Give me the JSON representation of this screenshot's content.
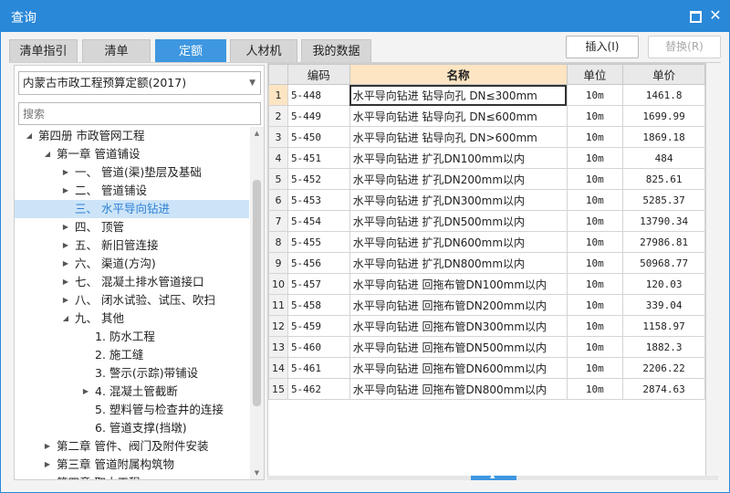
{
  "window": {
    "title": "查询"
  },
  "tabs": [
    {
      "label": "清单指引",
      "active": false
    },
    {
      "label": "清单",
      "active": false
    },
    {
      "label": "定额",
      "active": true
    },
    {
      "label": "人材机",
      "active": false
    },
    {
      "label": "我的数据",
      "active": false
    }
  ],
  "toolbar": {
    "insert_label": "插入(I)",
    "replace_label": "替换(R)"
  },
  "quota_select": {
    "value": "内蒙古市政工程预算定额(2017)"
  },
  "search": {
    "placeholder": "搜索"
  },
  "tree": [
    {
      "label": "第四册  市政管网工程",
      "level": 0,
      "toggle": "expanded",
      "selected": false
    },
    {
      "label": "第一章  管道铺设",
      "level": 1,
      "toggle": "expanded",
      "selected": false
    },
    {
      "label": "一、  管道(渠)垫层及基础",
      "level": 2,
      "toggle": "collapsed",
      "selected": false
    },
    {
      "label": "二、  管道铺设",
      "level": 2,
      "toggle": "collapsed",
      "selected": false
    },
    {
      "label": "三、  水平导向钻进",
      "level": 2,
      "toggle": "none",
      "selected": true
    },
    {
      "label": "四、  顶管",
      "level": 2,
      "toggle": "collapsed",
      "selected": false
    },
    {
      "label": "五、  新旧管连接",
      "level": 2,
      "toggle": "collapsed",
      "selected": false
    },
    {
      "label": "六、  渠道(方沟)",
      "level": 2,
      "toggle": "collapsed",
      "selected": false
    },
    {
      "label": "七、  混凝土排水管道接口",
      "level": 2,
      "toggle": "collapsed",
      "selected": false
    },
    {
      "label": "八、  闭水试验、试压、吹扫",
      "level": 2,
      "toggle": "collapsed",
      "selected": false
    },
    {
      "label": "九、  其他",
      "level": 2,
      "toggle": "expanded",
      "selected": false
    },
    {
      "label": "1. 防水工程",
      "level": 3,
      "toggle": "none",
      "selected": false
    },
    {
      "label": "2. 施工缝",
      "level": 3,
      "toggle": "none",
      "selected": false
    },
    {
      "label": "3. 警示(示踪)带铺设",
      "level": 3,
      "toggle": "none",
      "selected": false
    },
    {
      "label": "4. 混凝土管截断",
      "level": 3,
      "toggle": "collapsed",
      "selected": false
    },
    {
      "label": "5. 塑料管与检查井的连接",
      "level": 3,
      "toggle": "none",
      "selected": false
    },
    {
      "label": "6. 管道支撑(挡墩)",
      "level": 3,
      "toggle": "none",
      "selected": false
    },
    {
      "label": "第二章  管件、阀门及附件安装",
      "level": 1,
      "toggle": "collapsed",
      "selected": false
    },
    {
      "label": "第三章  管道附属构筑物",
      "level": 1,
      "toggle": "collapsed",
      "selected": false
    },
    {
      "label": "第四章  取水工程",
      "level": 1,
      "toggle": "collapsed",
      "selected": false
    }
  ],
  "grid": {
    "columns": [
      "编码",
      "名称",
      "单位",
      "单价"
    ],
    "rows": [
      {
        "no": "1",
        "code": "5-448",
        "name": "水平导向钻进 钻导向孔 DN≤300mm",
        "unit": "10m",
        "price": "1461.8"
      },
      {
        "no": "2",
        "code": "5-449",
        "name": "水平导向钻进 钻导向孔 DN≤600mm",
        "unit": "10m",
        "price": "1699.99"
      },
      {
        "no": "3",
        "code": "5-450",
        "name": "水平导向钻进 钻导向孔 DN>600mm",
        "unit": "10m",
        "price": "1869.18"
      },
      {
        "no": "4",
        "code": "5-451",
        "name": "水平导向钻进 扩孔DN100mm以内",
        "unit": "10m",
        "price": "484"
      },
      {
        "no": "5",
        "code": "5-452",
        "name": "水平导向钻进 扩孔DN200mm以内",
        "unit": "10m",
        "price": "825.61"
      },
      {
        "no": "6",
        "code": "5-453",
        "name": "水平导向钻进 扩孔DN300mm以内",
        "unit": "10m",
        "price": "5285.37"
      },
      {
        "no": "7",
        "code": "5-454",
        "name": "水平导向钻进 扩孔DN500mm以内",
        "unit": "10m",
        "price": "13790.34"
      },
      {
        "no": "8",
        "code": "5-455",
        "name": "水平导向钻进 扩孔DN600mm以内",
        "unit": "10m",
        "price": "27986.81"
      },
      {
        "no": "9",
        "code": "5-456",
        "name": "水平导向钻进 扩孔DN800mm以内",
        "unit": "10m",
        "price": "50968.77"
      },
      {
        "no": "10",
        "code": "5-457",
        "name": "水平导向钻进 回拖布管DN100mm以内",
        "unit": "10m",
        "price": "120.03"
      },
      {
        "no": "11",
        "code": "5-458",
        "name": "水平导向钻进 回拖布管DN200mm以内",
        "unit": "10m",
        "price": "339.04"
      },
      {
        "no": "12",
        "code": "5-459",
        "name": "水平导向钻进 回拖布管DN300mm以内",
        "unit": "10m",
        "price": "1158.97"
      },
      {
        "no": "13",
        "code": "5-460",
        "name": "水平导向钻进 回拖布管DN500mm以内",
        "unit": "10m",
        "price": "1882.3"
      },
      {
        "no": "14",
        "code": "5-461",
        "name": "水平导向钻进 回拖布管DN600mm以内",
        "unit": "10m",
        "price": "2206.22"
      },
      {
        "no": "15",
        "code": "5-462",
        "name": "水平导向钻进 回拖布管DN800mm以内",
        "unit": "10m",
        "price": "2874.63"
      }
    ]
  },
  "colors": {
    "accent": "#2a88d8",
    "selected_header": "#fde4c2",
    "tree_selected": "#cde4f8"
  }
}
